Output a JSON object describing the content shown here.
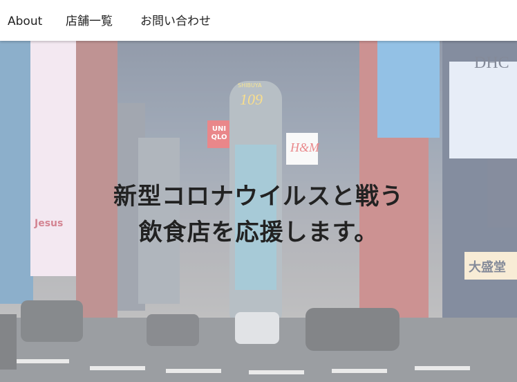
{
  "nav": {
    "about": "About",
    "stores": "店舗一覧",
    "contact": "お問い合わせ"
  },
  "hero": {
    "line1": "新型コロナウイルスと戦う",
    "line2": "飲食店を応援します。",
    "billboards": {
      "dhc": "DHC",
      "building": "109",
      "building_top": "SHIBUYA",
      "uniqlo": "UNI QLO",
      "hm": "H&M",
      "jesus": "Jesus",
      "daimori": "大盛堂"
    }
  },
  "colors": {
    "nav_bg": "#ffffff",
    "text": "#222222",
    "overlay": "rgba(255,255,255,0.45)"
  }
}
